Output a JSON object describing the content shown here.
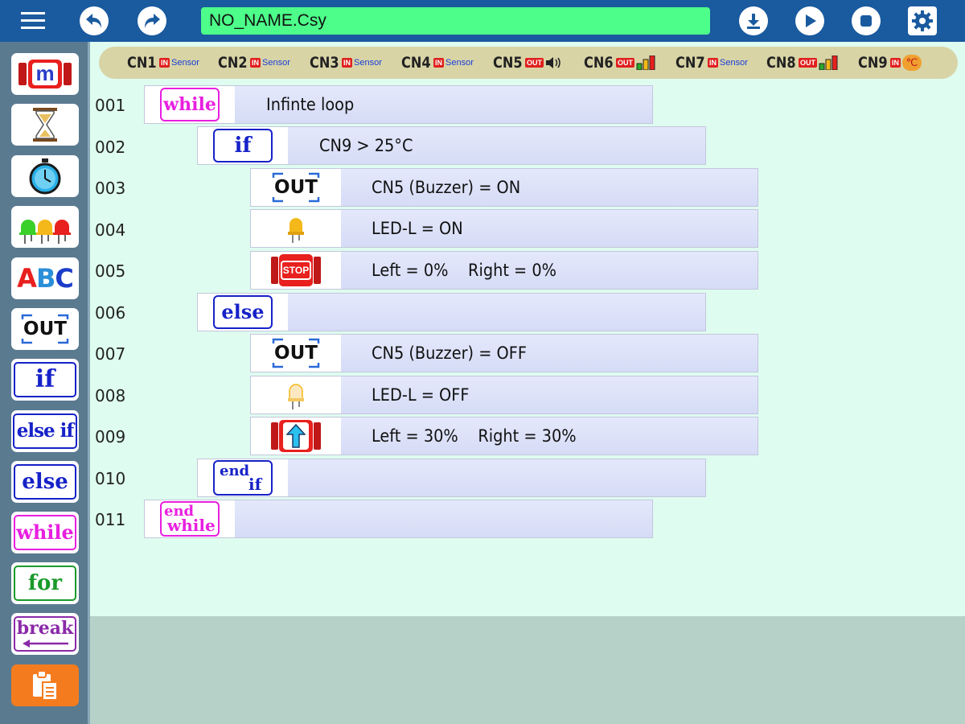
{
  "header": {
    "menu_icon": "hamburger-icon",
    "undo_icon": "undo-icon",
    "redo_icon": "redo-icon",
    "filename": "NO_NAME.Csy",
    "download_icon": "download-icon",
    "play_icon": "play-icon",
    "stop_icon": "stop-icon",
    "settings_icon": "gear-icon"
  },
  "sidebar": {
    "items": [
      {
        "id": "motor",
        "icon": "robot-motor-icon",
        "label": "m"
      },
      {
        "id": "timer",
        "icon": "hourglass-icon"
      },
      {
        "id": "stopwatch",
        "icon": "stopwatch-icon"
      },
      {
        "id": "leds",
        "icon": "led-icon"
      },
      {
        "id": "text",
        "label": "ABC"
      },
      {
        "id": "out",
        "label": "OUT"
      },
      {
        "id": "if",
        "label": "if"
      },
      {
        "id": "elseif",
        "label": "else if"
      },
      {
        "id": "else",
        "label": "else"
      },
      {
        "id": "while",
        "label": "while"
      },
      {
        "id": "for",
        "label": "for"
      },
      {
        "id": "break",
        "label": "break"
      },
      {
        "id": "paste",
        "icon": "clipboard-icon"
      }
    ]
  },
  "connectors": [
    {
      "name": "CN1",
      "mode": "IN",
      "type": "Sensor"
    },
    {
      "name": "CN2",
      "mode": "IN",
      "type": "Sensor"
    },
    {
      "name": "CN3",
      "mode": "IN",
      "type": "Sensor"
    },
    {
      "name": "CN4",
      "mode": "IN",
      "type": "Sensor"
    },
    {
      "name": "CN5",
      "mode": "OUT",
      "type": "speaker-icon"
    },
    {
      "name": "CN6",
      "mode": "OUT",
      "type": "level-meter-icon"
    },
    {
      "name": "CN7",
      "mode": "IN",
      "type": "Sensor"
    },
    {
      "name": "CN8",
      "mode": "OUT",
      "type": "level-meter-icon"
    },
    {
      "name": "CN9",
      "mode": "IN",
      "type": "temperature-icon"
    }
  ],
  "program": {
    "lines": [
      {
        "num": "001",
        "block": "while",
        "text": "Infinte loop"
      },
      {
        "num": "002",
        "block": "if",
        "text": "CN9 > 25°C"
      },
      {
        "num": "003",
        "block": "OUT",
        "text": "CN5 (Buzzer) = ON"
      },
      {
        "num": "004",
        "block": "led-on-icon",
        "text": "LED-L = ON"
      },
      {
        "num": "005",
        "block": "stop-motor-icon",
        "text": "Left = 0%    Right = 0%"
      },
      {
        "num": "006",
        "block": "else",
        "text": ""
      },
      {
        "num": "007",
        "block": "OUT",
        "text": "CN5 (Buzzer) = OFF"
      },
      {
        "num": "008",
        "block": "led-off-icon",
        "text": "LED-L = OFF"
      },
      {
        "num": "009",
        "block": "forward-motor-icon",
        "text": "Left = 30%    Right = 30%"
      },
      {
        "num": "010",
        "block": "end if",
        "text": ""
      },
      {
        "num": "011",
        "block": "end while",
        "text": ""
      }
    ]
  },
  "labels": {
    "end": "end",
    "if": "if",
    "while": "while",
    "stop": "STOP",
    "c": "℃"
  }
}
